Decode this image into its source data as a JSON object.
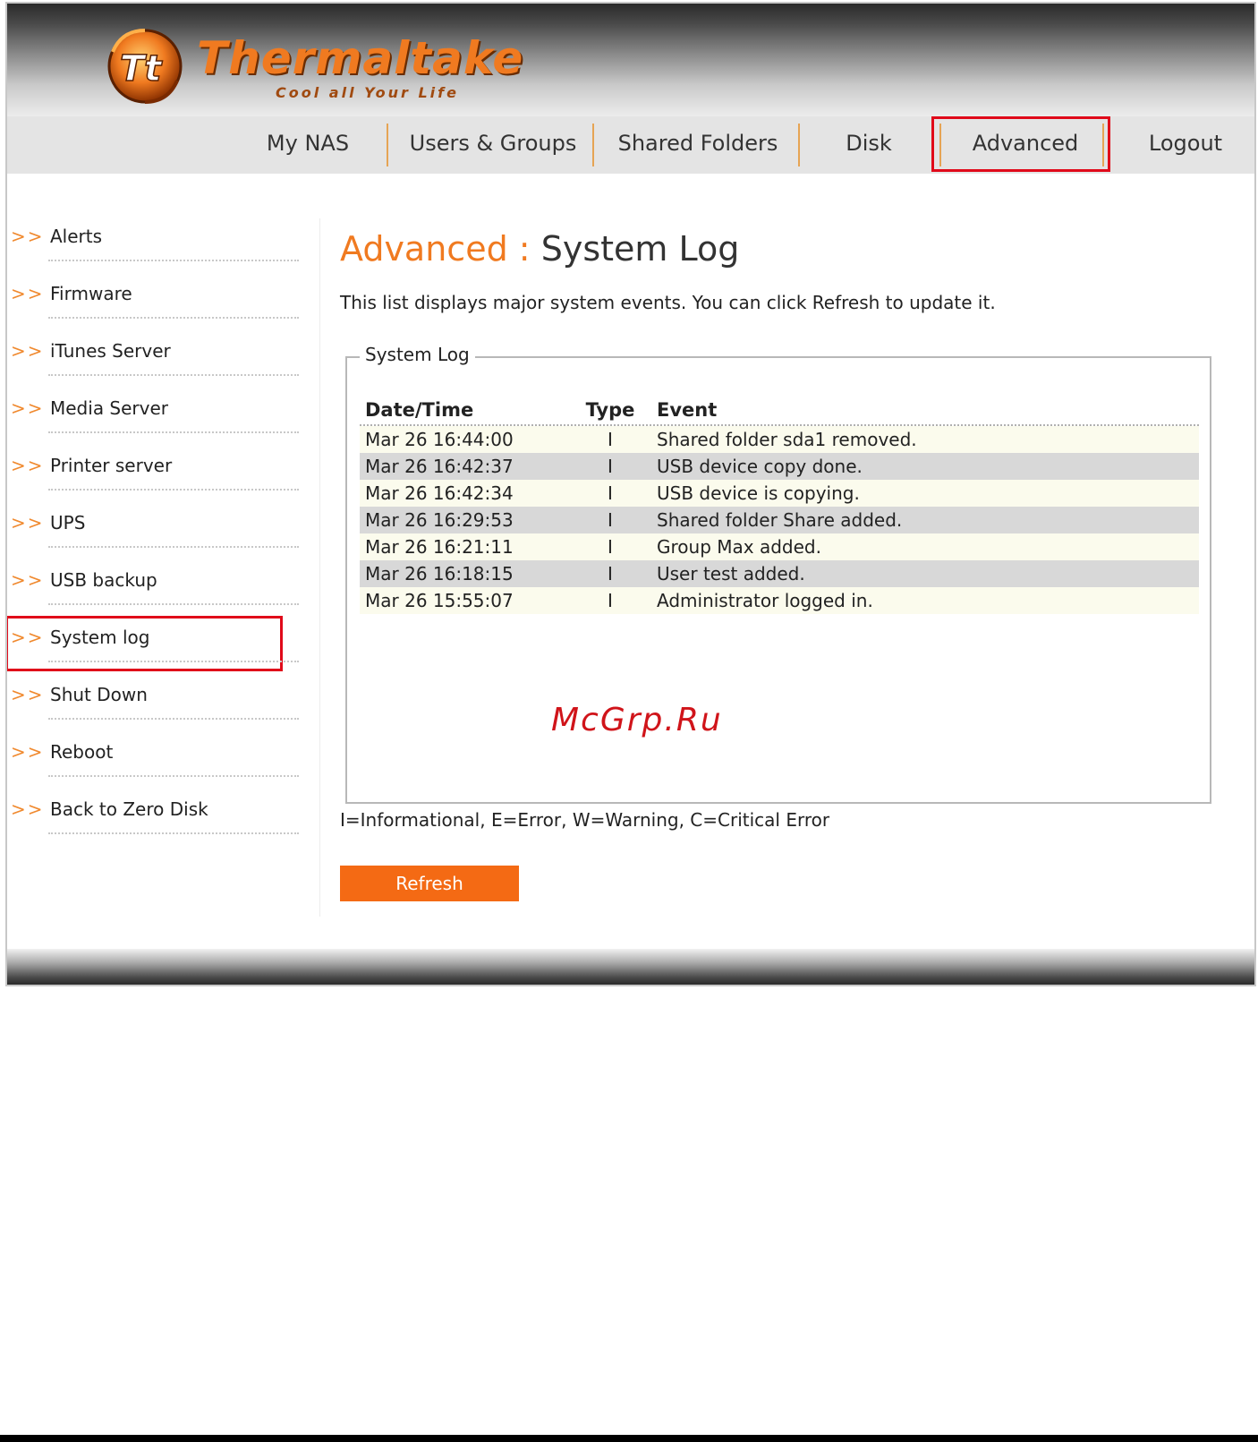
{
  "brand": {
    "name": "Thermaltake",
    "tagline": "Cool all Your Life",
    "logo_letters": "Tt",
    "colors": {
      "accent": "#f07a20",
      "highlight": "#e00a1a",
      "button": "#f46a14"
    }
  },
  "nav": {
    "items": [
      {
        "label": "My NAS"
      },
      {
        "label": "Users & Groups"
      },
      {
        "label": "Shared Folders"
      },
      {
        "label": "Disk"
      },
      {
        "label": "Advanced"
      },
      {
        "label": "Logout"
      }
    ],
    "active": "Advanced"
  },
  "sidebar": {
    "arrow": ">>",
    "items": [
      {
        "label": "Alerts"
      },
      {
        "label": "Firmware"
      },
      {
        "label": "iTunes Server"
      },
      {
        "label": "Media Server"
      },
      {
        "label": "Printer server"
      },
      {
        "label": "UPS"
      },
      {
        "label": "USB backup"
      },
      {
        "label": "System log"
      },
      {
        "label": "Shut Down"
      },
      {
        "label": "Reboot"
      },
      {
        "label": "Back to Zero Disk"
      }
    ],
    "active": "System log"
  },
  "main": {
    "title_category": "Advanced",
    "title_separator": ":",
    "title_page": "System Log",
    "description": "This list displays major system events. You can click Refresh to update it.",
    "log_box_title": "System Log",
    "columns": {
      "date": "Date/Time",
      "type": "Type",
      "event": "Event"
    },
    "rows": [
      {
        "date": "Mar 26 16:44:00",
        "type": "I",
        "event": "Shared folder sda1 removed."
      },
      {
        "date": "Mar 26 16:42:37",
        "type": "I",
        "event": "USB device copy done."
      },
      {
        "date": "Mar 26 16:42:34",
        "type": "I",
        "event": "USB device is copying."
      },
      {
        "date": "Mar 26 16:29:53",
        "type": "I",
        "event": "Shared folder Share added."
      },
      {
        "date": "Mar 26 16:21:11",
        "type": "I",
        "event": "Group Max added."
      },
      {
        "date": "Mar 26 16:18:15",
        "type": "I",
        "event": "User test added."
      },
      {
        "date": "Mar 26 15:55:07",
        "type": "I",
        "event": "Administrator logged in."
      }
    ],
    "type_legend": "I=Informational, E=Error, W=Warning, C=Critical Error",
    "refresh_label": "Refresh"
  },
  "watermark": "McGrp.Ru"
}
